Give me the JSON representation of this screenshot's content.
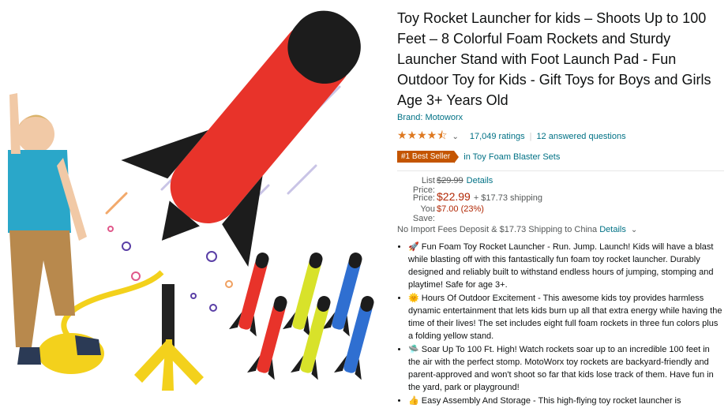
{
  "product": {
    "title": "Toy Rocket Launcher for kids – Shoots Up to 100 Feet – 8 Colorful Foam Rockets and Sturdy Launcher Stand with Foot Launch Pad - Fun Outdoor Toy for Kids - Gift Toys for Boys and Girls Age 3+ Years Old",
    "brand": "Brand: Motoworx",
    "rating_stars": "★★★★⯪",
    "ratings_count": "17,049 ratings",
    "answered": "12 answered questions",
    "best_seller_badge": "#1 Best Seller",
    "best_seller_category": "in Toy Foam Blaster Sets"
  },
  "pricing": {
    "list_label": "List Price:",
    "list_value": "$29.99",
    "details_label": "Details",
    "price_label": "Price:",
    "price_value": "$22.99",
    "shipping": "+ $17.73 shipping",
    "save_label": "You Save:",
    "save_value": "$7.00 (23%)"
  },
  "import_fees": {
    "text": "No Import Fees Deposit & $17.73 Shipping to China",
    "link": "Details"
  },
  "bullets": [
    {
      "icon": "🚀",
      "text": "Fun Foam Toy Rocket Launcher - Run. Jump. Launch! Kids will have a blast while blasting off with this fantastically fun foam toy rocket launcher. Durably designed and reliably built to withstand endless hours of jumping, stomping and playtime! Safe for age 3+."
    },
    {
      "icon": "🌞",
      "text": "Hours Of Outdoor Excitement - This awesome kids toy provides harmless dynamic entertainment that lets kids burn up all that extra energy while having the time of their lives! The set includes eight full foam rockets in three fun colors plus a folding yellow stand."
    },
    {
      "icon": "🛸",
      "text": "Soar Up To 100 Ft. High! Watch rockets soar up to an incredible 100 feet in the air with the perfect stomp. MotoWorx toy rockets are backyard-friendly and parent-approved and won't shoot so far that kids lose track of them. Have fun in the yard, park or playground!"
    },
    {
      "icon": "👍",
      "text": "Easy Assembly And Storage - This high-flying toy rocket launcher is"
    }
  ],
  "colors": {
    "rocket_red": "#e8332a",
    "rocket_yellow": "#d8e22a",
    "rocket_blue": "#2f6fd1",
    "foam_black": "#1c1c1c",
    "pad_yellow": "#f3d11c",
    "link": "#007185",
    "price": "#b12704",
    "badge": "#c45500"
  }
}
